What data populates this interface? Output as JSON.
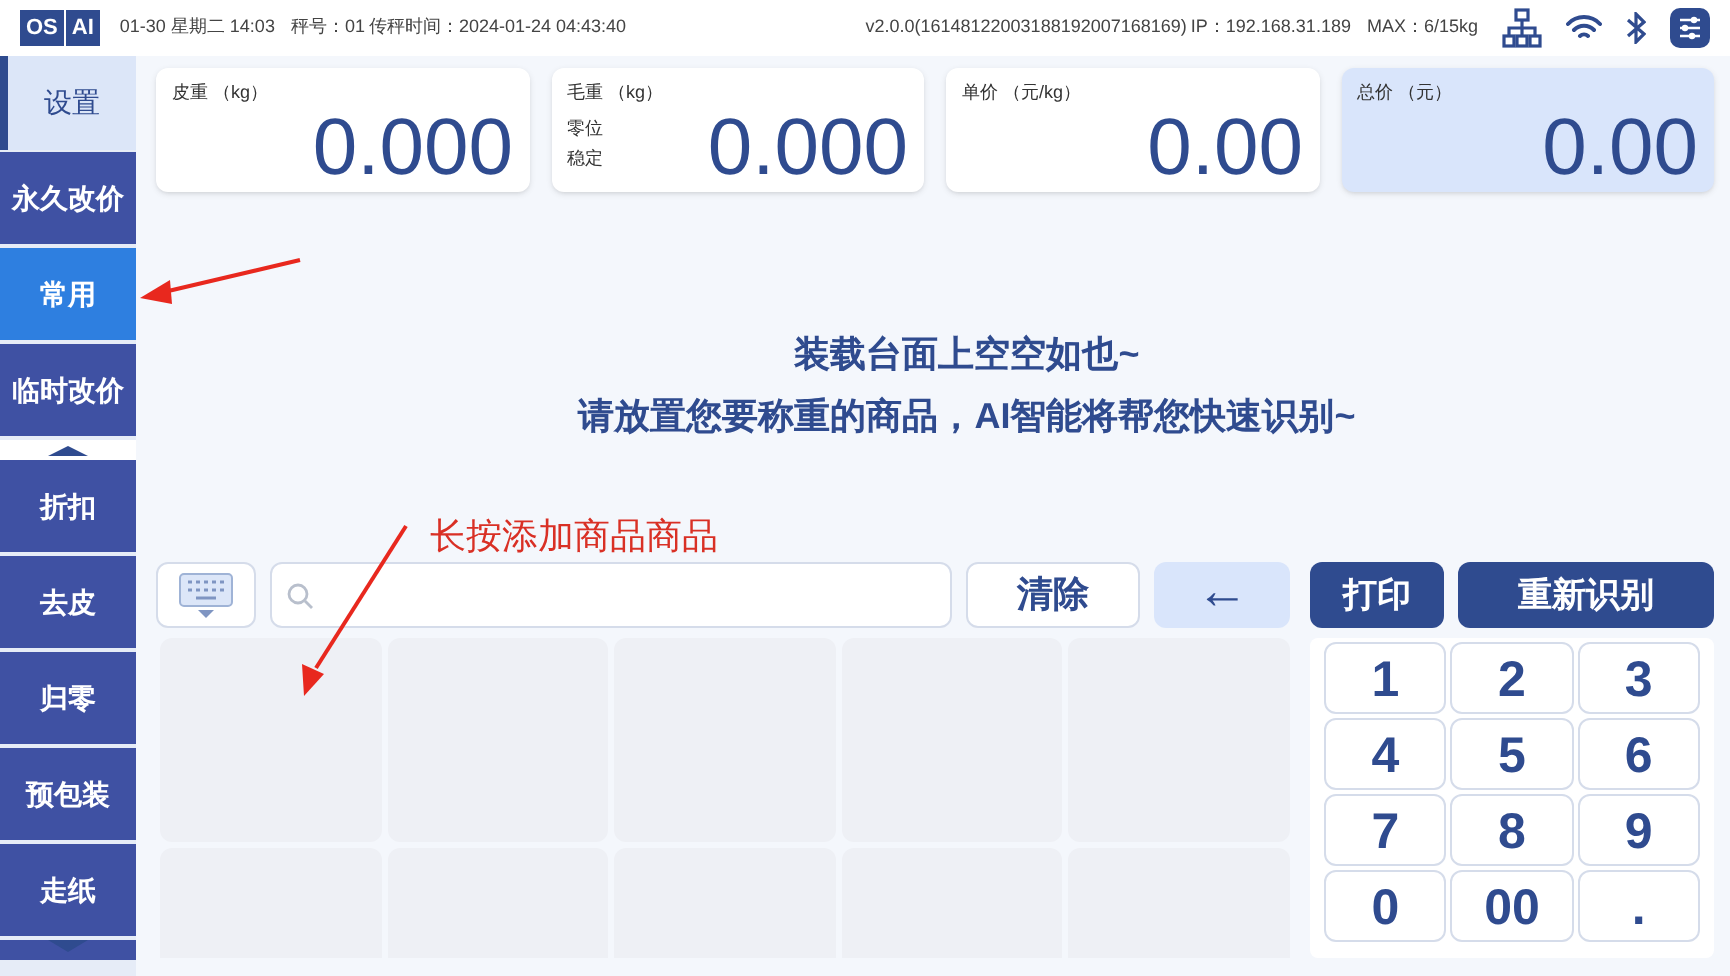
{
  "status_bar": {
    "logo": [
      "OS",
      "AI"
    ],
    "datetime": "01-30 星期二 14:03",
    "scale_no": "秤号：01",
    "transfer_time": "传秤时间：2024-01-24 04:43:40",
    "version": "v2.0.0(16148122003188192007168169)",
    "ip": "IP：192.168.31.189",
    "max": "MAX：6/15kg"
  },
  "sidebar": {
    "items": [
      {
        "label": "设置",
        "kind": "header",
        "selected": false
      },
      {
        "label": "永久改价",
        "kind": "item",
        "selected": false
      },
      {
        "label": "常用",
        "kind": "item",
        "selected": true
      },
      {
        "label": "临时改价",
        "kind": "item",
        "selected": false
      },
      {
        "kind": "scroll_up"
      },
      {
        "label": "折扣",
        "kind": "item",
        "selected": false
      },
      {
        "label": "去皮",
        "kind": "item",
        "selected": false
      },
      {
        "label": "归零",
        "kind": "item",
        "selected": false
      },
      {
        "label": "预包装",
        "kind": "item",
        "selected": false
      },
      {
        "label": "走纸",
        "kind": "item",
        "selected": false
      },
      {
        "kind": "scroll_down"
      }
    ]
  },
  "readouts": [
    {
      "label": "皮重 （kg）",
      "value": "0.000",
      "highlight": false
    },
    {
      "label": "毛重 （kg）",
      "value": "0.000",
      "flags": [
        "零位",
        "稳定"
      ],
      "highlight": false
    },
    {
      "label": "单价 （元/kg）",
      "value": "0.00",
      "highlight": false
    },
    {
      "label": "总价 （元）",
      "value": "0.00",
      "highlight": true
    }
  ],
  "message": [
    "装载台面上空空如也~",
    "请放置您要称重的商品，AI智能将帮您快速识别~"
  ],
  "annotation": "长按添加商品商品",
  "search": {
    "clear": "清除",
    "backspace": "←"
  },
  "actions": [
    "打印",
    "重新识别"
  ],
  "keypad": [
    "1",
    "2",
    "3",
    "4",
    "5",
    "6",
    "7",
    "8",
    "9",
    "0",
    "00",
    "."
  ]
}
